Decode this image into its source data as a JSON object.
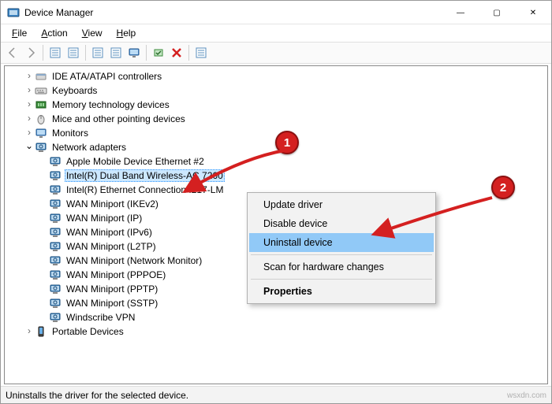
{
  "window": {
    "title": "Device Manager",
    "buttons": {
      "min": "—",
      "max": "▢",
      "close": "✕"
    }
  },
  "menu": [
    "File",
    "Action",
    "View",
    "Help"
  ],
  "toolbar": [
    {
      "name": "back-icon",
      "interact": false
    },
    {
      "name": "forward-icon",
      "interact": false
    },
    {
      "name": "sep"
    },
    {
      "name": "show-hidden-icon",
      "interact": true
    },
    {
      "name": "help-icon",
      "interact": true
    },
    {
      "name": "sep"
    },
    {
      "name": "properties-icon",
      "interact": true
    },
    {
      "name": "update-icon",
      "interact": true
    },
    {
      "name": "scan-icon",
      "interact": true
    },
    {
      "name": "sep"
    },
    {
      "name": "enable-icon",
      "interact": true
    },
    {
      "name": "uninstall-icon",
      "interact": true
    },
    {
      "name": "sep"
    },
    {
      "name": "disable-icon",
      "interact": true
    }
  ],
  "tree": [
    {
      "depth": 1,
      "caret": "closed",
      "icon": "controller",
      "label": "IDE ATA/ATAPI controllers"
    },
    {
      "depth": 1,
      "caret": "closed",
      "icon": "keyboard",
      "label": "Keyboards"
    },
    {
      "depth": 1,
      "caret": "closed",
      "icon": "memory",
      "label": "Memory technology devices"
    },
    {
      "depth": 1,
      "caret": "closed",
      "icon": "mouse",
      "label": "Mice and other pointing devices"
    },
    {
      "depth": 1,
      "caret": "closed",
      "icon": "monitor",
      "label": "Monitors"
    },
    {
      "depth": 1,
      "caret": "open",
      "icon": "network",
      "label": "Network adapters"
    },
    {
      "depth": 2,
      "caret": "none",
      "icon": "network",
      "label": "Apple Mobile Device Ethernet #2"
    },
    {
      "depth": 2,
      "caret": "none",
      "icon": "network",
      "label": "Intel(R) Dual Band Wireless-AC 7260",
      "selected": true
    },
    {
      "depth": 2,
      "caret": "none",
      "icon": "network",
      "label": "Intel(R) Ethernet Connection I217-LM"
    },
    {
      "depth": 2,
      "caret": "none",
      "icon": "network",
      "label": "WAN Miniport (IKEv2)"
    },
    {
      "depth": 2,
      "caret": "none",
      "icon": "network",
      "label": "WAN Miniport (IP)"
    },
    {
      "depth": 2,
      "caret": "none",
      "icon": "network",
      "label": "WAN Miniport (IPv6)"
    },
    {
      "depth": 2,
      "caret": "none",
      "icon": "network",
      "label": "WAN Miniport (L2TP)"
    },
    {
      "depth": 2,
      "caret": "none",
      "icon": "network",
      "label": "WAN Miniport (Network Monitor)"
    },
    {
      "depth": 2,
      "caret": "none",
      "icon": "network",
      "label": "WAN Miniport (PPPOE)"
    },
    {
      "depth": 2,
      "caret": "none",
      "icon": "network",
      "label": "WAN Miniport (PPTP)"
    },
    {
      "depth": 2,
      "caret": "none",
      "icon": "network",
      "label": "WAN Miniport (SSTP)"
    },
    {
      "depth": 2,
      "caret": "none",
      "icon": "network",
      "label": "Windscribe VPN"
    },
    {
      "depth": 1,
      "caret": "closed",
      "icon": "portable",
      "label": "Portable Devices"
    }
  ],
  "context_menu": {
    "items": [
      {
        "label": "Update driver",
        "highlight": false
      },
      {
        "label": "Disable device",
        "highlight": false
      },
      {
        "label": "Uninstall device",
        "highlight": true
      },
      {
        "sep": true
      },
      {
        "label": "Scan for hardware changes",
        "highlight": false
      },
      {
        "sep": true
      },
      {
        "label": "Properties",
        "highlight": false,
        "bold": true
      }
    ]
  },
  "status": "Uninstalls the driver for the selected device.",
  "annotations": {
    "badge1": "1",
    "badge2": "2"
  },
  "watermark": "wsxdn.com"
}
